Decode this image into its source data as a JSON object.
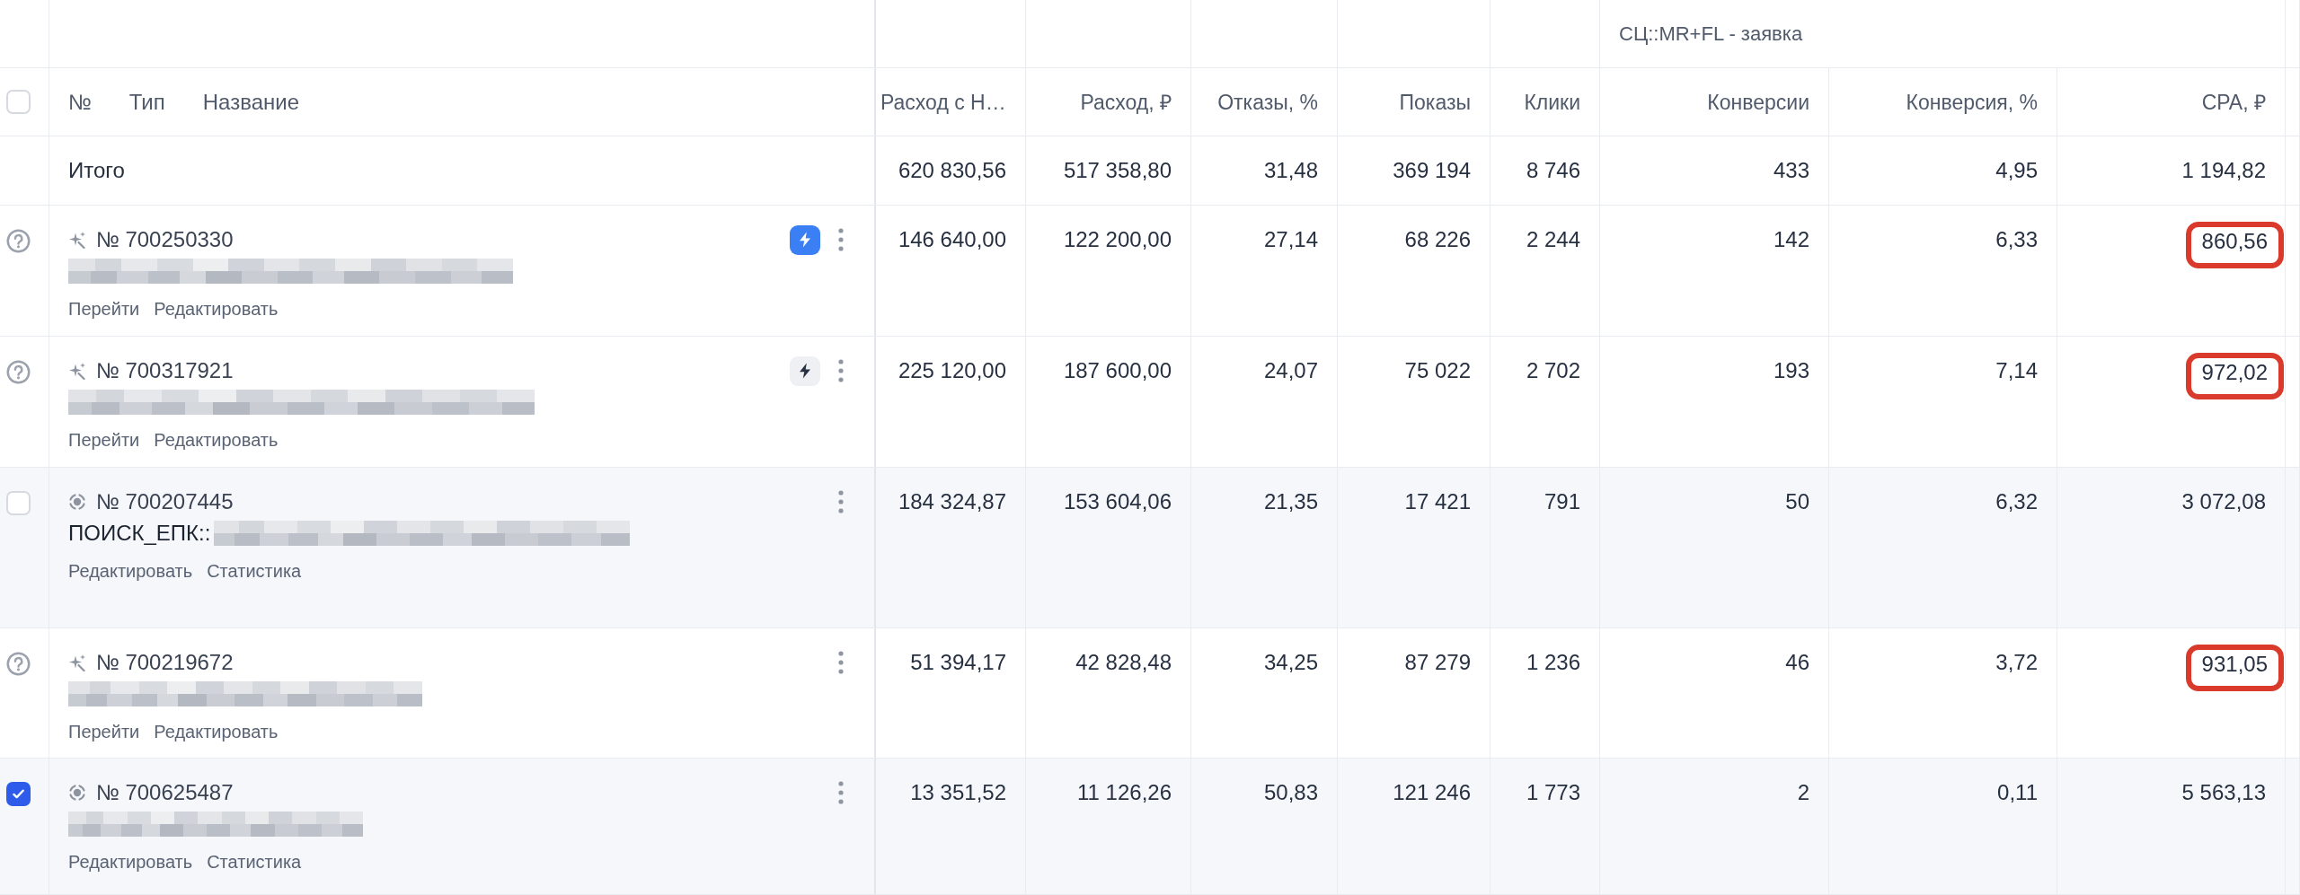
{
  "header": {
    "select_all": {
      "checked": false
    },
    "name_columns": [
      "№",
      "Тип",
      "Название"
    ],
    "group": {
      "label": "СЦ::MR+FL - заявка"
    },
    "columns": [
      "Расход с Н…",
      "Расход, ₽",
      "Отказы, %",
      "Показы",
      "Клики",
      "Конверсии",
      "Конверсия, %",
      "CPA, ₽"
    ]
  },
  "total": {
    "label": "Итого",
    "values": [
      "620 830,56",
      "517 358,80",
      "31,48",
      "369 194",
      "8 746",
      "433",
      "4,95",
      "1 194,82"
    ]
  },
  "rows": [
    {
      "selector": {
        "kind": "help"
      },
      "type_icon": {
        "kind": "sparkle"
      },
      "number": "№ 700250330",
      "boost": {
        "active": true
      },
      "links": [
        "Перейти",
        "Редактировать"
      ],
      "values": [
        "146 640,00",
        "122 200,00",
        "27,14",
        "68 226",
        "2 244",
        "142",
        "6,33",
        "860,56"
      ],
      "cpa_marked": true
    },
    {
      "selector": {
        "kind": "help"
      },
      "type_icon": {
        "kind": "sparkle"
      },
      "number": "№ 700317921",
      "boost": {
        "active": false
      },
      "links": [
        "Перейти",
        "Редактировать"
      ],
      "values": [
        "225 120,00",
        "187 600,00",
        "24,07",
        "75 022",
        "2 702",
        "193",
        "7,14",
        "972,02"
      ],
      "cpa_marked": true
    },
    {
      "selector": {
        "kind": "checkbox",
        "checked": false
      },
      "type_icon": {
        "kind": "target"
      },
      "number": "№ 700207445",
      "name": "ПОИСК_ЕПК::",
      "links": [
        "Редактировать",
        "Статистика"
      ],
      "values": [
        "184 324,87",
        "153 604,06",
        "21,35",
        "17 421",
        "791",
        "50",
        "6,32",
        "3 072,08"
      ],
      "cpa_marked": false
    },
    {
      "selector": {
        "kind": "help"
      },
      "type_icon": {
        "kind": "sparkle"
      },
      "number": "№ 700219672",
      "links": [
        "Перейти",
        "Редактировать"
      ],
      "values": [
        "51 394,17",
        "42 828,48",
        "34,25",
        "87 279",
        "1 236",
        "46",
        "3,72",
        "931,05"
      ],
      "cpa_marked": true
    },
    {
      "selector": {
        "kind": "checkbox",
        "checked": true
      },
      "type_icon": {
        "kind": "target"
      },
      "number": "№ 700625487",
      "links": [
        "Редактировать",
        "Статистика"
      ],
      "values": [
        "13 351,52",
        "11 126,26",
        "50,83",
        "121 246",
        "1 773",
        "2",
        "0,11",
        "5 563,13"
      ],
      "cpa_marked": false
    }
  ]
}
